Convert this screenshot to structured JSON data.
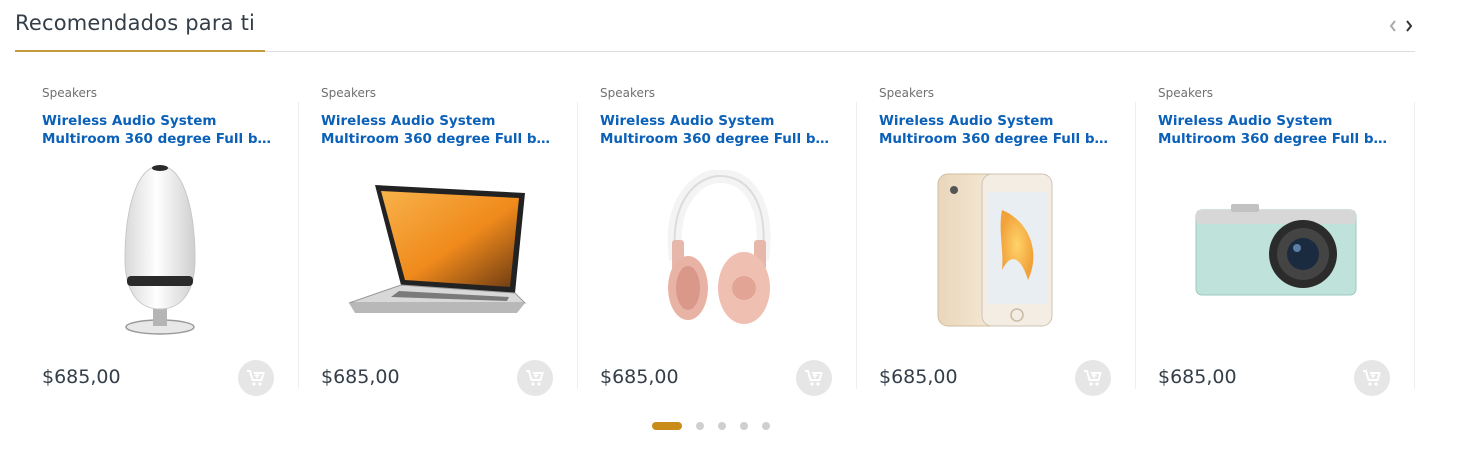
{
  "section": {
    "title": "Recomendados para ti"
  },
  "colors": {
    "accent": "#c98c19",
    "link": "#0b60b8"
  },
  "products": [
    {
      "category": "Speakers",
      "name_line1": "Wireless Audio System",
      "name_line2": "Multiroom 360 degree Full bas...",
      "price": "$685,00",
      "image": "speaker-image"
    },
    {
      "category": "Speakers",
      "name_line1": "Wireless Audio System",
      "name_line2": "Multiroom 360 degree Full bas...",
      "price": "$685,00",
      "image": "laptop-image"
    },
    {
      "category": "Speakers",
      "name_line1": "Wireless Audio System",
      "name_line2": "Multiroom 360 degree Full bas...",
      "price": "$685,00",
      "image": "headphones-image"
    },
    {
      "category": "Speakers",
      "name_line1": "Wireless Audio System",
      "name_line2": "Multiroom 360 degree Full bas...",
      "price": "$685,00",
      "image": "smartphone-image"
    },
    {
      "category": "Speakers",
      "name_line1": "Wireless Audio System",
      "name_line2": "Multiroom 360 degree Full bas...",
      "price": "$685,00",
      "image": "camera-image"
    }
  ],
  "icons": {
    "prev": "chevron-left-icon",
    "next": "chevron-right-icon",
    "cart": "add-to-cart-icon"
  },
  "pagination": {
    "pages": 5,
    "active": 1
  }
}
